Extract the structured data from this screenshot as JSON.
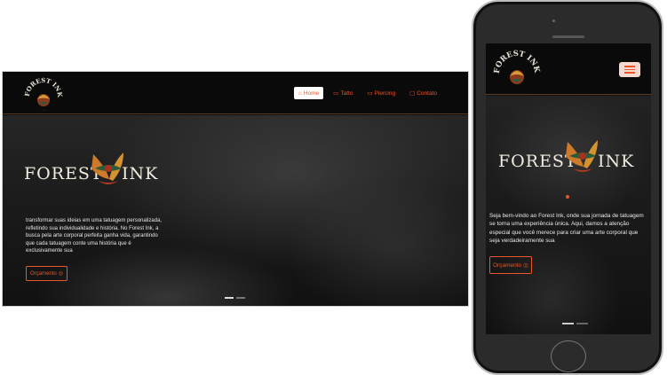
{
  "desktop": {
    "logo_text": "FOREST INK",
    "nav": [
      {
        "label": "Home",
        "icon": "home-icon",
        "active": true
      },
      {
        "label": "Tatto",
        "icon": "calendar-icon",
        "active": false
      },
      {
        "label": "Piercing",
        "icon": "calendar-icon",
        "active": false
      },
      {
        "label": "Contato",
        "icon": "message-icon",
        "active": false
      }
    ],
    "brand_left": "FOREST",
    "brand_right": "INK",
    "intro": "transformar suas ideias em uma tatuagem personalizada, refletindo sua individualidade e história. No Forest Ink, a busca pela arte corporal perfeita ganha vida, garantindo que cada tatuagem conte uma história que é exclusivamente sua",
    "cta": "Orçamento"
  },
  "mobile": {
    "logo_text": "FOREST INK",
    "brand_left": "FOREST",
    "brand_right": "INK",
    "intro": "Seja bem-vindo ao Forest Ink, onde sua jornada de tatuagem se torna uma experiência única. Aqui, damos a atenção especial que você merece para criar uma arte corporal que seja verdadeiramente sua",
    "cta": "Orçamento"
  },
  "colors": {
    "accent": "#e8562b",
    "background": "#0b0b0b"
  }
}
